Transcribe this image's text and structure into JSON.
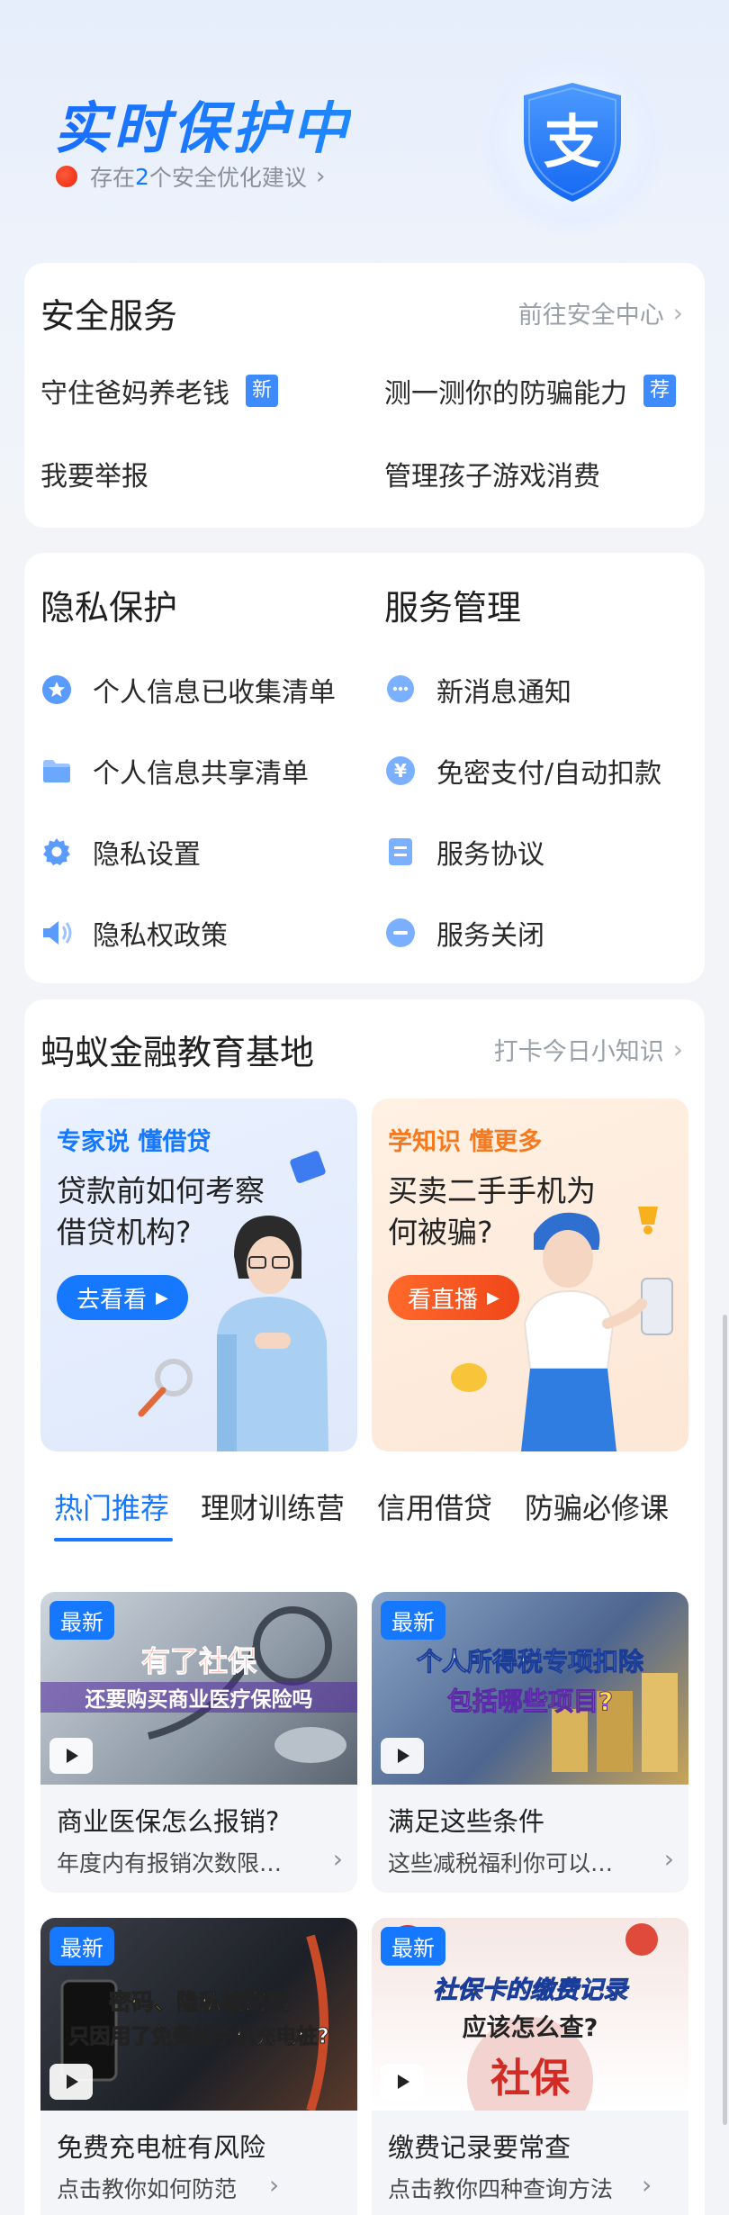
{
  "header": {
    "title": "实时保护中",
    "status_prefix": "存在",
    "status_count": "2",
    "status_suffix": "个安全优化建议",
    "shield_glyph": "支"
  },
  "safety_services": {
    "title": "安全服务",
    "link": "前往安全中心",
    "items": [
      {
        "label": "守住爸妈养老钱",
        "badge": "新"
      },
      {
        "label": "测一测你的防骗能力",
        "badge": "荐"
      },
      {
        "label": "我要举报",
        "badge": ""
      },
      {
        "label": "管理孩子游戏消费",
        "badge": ""
      }
    ]
  },
  "privacy": {
    "title": "隐私保护",
    "items": [
      {
        "label": "个人信息已收集清单",
        "icon": "star-badge-icon"
      },
      {
        "label": "个人信息共享清单",
        "icon": "folder-icon"
      },
      {
        "label": "隐私设置",
        "icon": "gear-icon"
      },
      {
        "label": "隐私权政策",
        "icon": "speaker-icon"
      }
    ]
  },
  "service_mgmt": {
    "title": "服务管理",
    "items": [
      {
        "label": "新消息通知",
        "icon": "chat-bubble-icon"
      },
      {
        "label": "免密支付/自动扣款",
        "icon": "yen-icon"
      },
      {
        "label": "服务协议",
        "icon": "document-icon"
      },
      {
        "label": "服务关闭",
        "icon": "minus-circle-icon"
      }
    ]
  },
  "education": {
    "title": "蚂蚁金融教育基地",
    "link": "打卡今日小知识",
    "promos": [
      {
        "tag": "专家说 懂借贷",
        "question": "贷款前如何考察借贷机构?",
        "button": "去看看"
      },
      {
        "tag": "学知识 懂更多",
        "question": "买卖二手手机为何被骗?",
        "button": "看直播"
      }
    ],
    "tabs": [
      "热门推荐",
      "理财训练营",
      "信用借贷",
      "防骗必修课"
    ],
    "active_tab": 0,
    "videos": [
      {
        "badge": "最新",
        "cover_line1": "有了社保",
        "cover_line2": "还要购买商业医疗保险吗",
        "title": "商业医保怎么报销?",
        "subtitle": "年度内有报销次数限…"
      },
      {
        "badge": "最新",
        "cover_line1": "个人所得税专项扣除",
        "cover_line2": "包括哪些项目?",
        "title": "满足这些条件",
        "subtitle": "这些减税福利你可以…"
      },
      {
        "badge": "最新",
        "cover_line1": "密码、隐私被窃取",
        "cover_line2": "只因用了免费的手机充电桩?",
        "title": "免费充电桩有风险",
        "subtitle": "点击教你如何防范"
      },
      {
        "badge": "最新",
        "cover_line1": "社保卡的缴费记录",
        "cover_line2": "应该怎么查?",
        "cover_line3": "社保",
        "title": "缴费记录要常查",
        "subtitle": "点击教你四种查询方法"
      }
    ]
  },
  "colors": {
    "accent": "#1677ff",
    "badge": "#3e8bff",
    "status_dot": "#e8260e"
  }
}
